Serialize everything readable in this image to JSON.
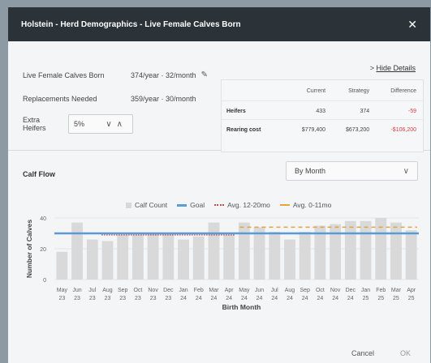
{
  "dialog": {
    "title": "Holstein - Herd Demographics - Live Female Calves Born",
    "close_icon": "close-icon"
  },
  "summary": {
    "born_label": "Live Female Calves Born",
    "born_value": "374/year  ·  32/month",
    "repl_label": "Replacements Needed",
    "repl_value": "359/year  ·  30/month",
    "extra_label": "Extra Heifers",
    "extra_value": "5%",
    "hide_prefix": ">",
    "hide_link": "Hide Details"
  },
  "table": {
    "headers": [
      "Current",
      "Strategy",
      "Difference"
    ],
    "rows": [
      {
        "label": "Heifers",
        "current": "433",
        "strategy": "374",
        "diff": "-59"
      },
      {
        "label": "Rearing cost",
        "current": "$779,400",
        "strategy": "$673,200",
        "diff": "-$106,200"
      }
    ]
  },
  "flow": {
    "title": "Calf Flow",
    "period": "By Month"
  },
  "legend": {
    "calf_count": "Calf Count",
    "goal": "Goal",
    "avg_12_20": "Avg. 12-20mo",
    "avg_0_11": "Avg. 0-11mo"
  },
  "colors": {
    "bar": "#d9d9d9",
    "goal": "#5b9bd5",
    "avg_12_20": "#c0504d",
    "avg_0_11": "#e6a23c",
    "negative": "#d94040"
  },
  "chart_data": {
    "type": "bar",
    "xlabel": "Birth Month",
    "ylabel": "Number of Calves",
    "ylim": [
      0,
      40
    ],
    "yticks": [
      0,
      20,
      40
    ],
    "categories": [
      [
        "May",
        "23"
      ],
      [
        "Jun",
        "23"
      ],
      [
        "Jul",
        "23"
      ],
      [
        "Aug",
        "23"
      ],
      [
        "Sep",
        "23"
      ],
      [
        "Oct",
        "23"
      ],
      [
        "Nov",
        "23"
      ],
      [
        "Dec",
        "23"
      ],
      [
        "Jan",
        "24"
      ],
      [
        "Feb",
        "24"
      ],
      [
        "Mar",
        "24"
      ],
      [
        "Apr",
        "24"
      ],
      [
        "May",
        "24"
      ],
      [
        "Jun",
        "24"
      ],
      [
        "Jul",
        "24"
      ],
      [
        "Aug",
        "24"
      ],
      [
        "Sep",
        "24"
      ],
      [
        "Oct",
        "24"
      ],
      [
        "Nov",
        "24"
      ],
      [
        "Dec",
        "24"
      ],
      [
        "Jan",
        "25"
      ],
      [
        "Feb",
        "25"
      ],
      [
        "Mar",
        "25"
      ],
      [
        "Apr",
        "25"
      ]
    ],
    "values": [
      18,
      37,
      26,
      25,
      29,
      29,
      30,
      30,
      26,
      28,
      37,
      29,
      37,
      34,
      31,
      26,
      31,
      35,
      36,
      38,
      38,
      40,
      37,
      32
    ],
    "goal": 30,
    "avg_12_20mo": {
      "value": 29,
      "from": 3,
      "to": 11
    },
    "avg_0_11mo": {
      "value": 34,
      "from": 12,
      "to": 23
    }
  },
  "footer": {
    "cancel": "Cancel",
    "ok": "OK"
  }
}
